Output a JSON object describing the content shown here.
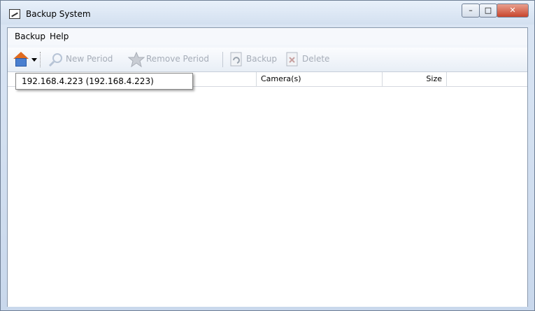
{
  "window": {
    "title": "Backup System",
    "controls": {
      "minimize": "–",
      "maximize": "□",
      "close": "✕"
    }
  },
  "menu": {
    "items": [
      "Backup",
      "Help"
    ]
  },
  "toolbar": {
    "home_icon": "home-icon",
    "new_period": "New Period",
    "remove_period": "Remove Period",
    "backup": "Backup",
    "delete": "Delete"
  },
  "listview": {
    "columns": [
      "",
      "Camera(s)",
      "Size",
      ""
    ]
  },
  "dropdown": {
    "items": [
      "192.168.4.223 (192.168.4.223)"
    ]
  }
}
